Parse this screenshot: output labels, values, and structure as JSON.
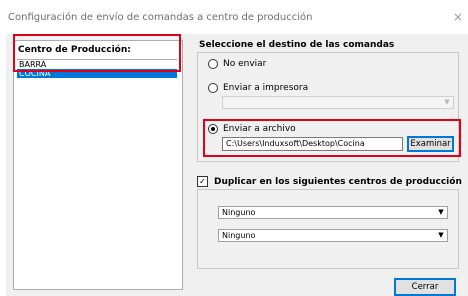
{
  "window": {
    "title": "Configuración de envío de comandas a centro de producción",
    "close_glyph": "×"
  },
  "left_panel": {
    "header": "Centro de Producción:",
    "items": [
      "BARRA",
      "COCINA"
    ],
    "selected_index": 1
  },
  "destination": {
    "header": "Seleccione el destino de las comandas",
    "options": [
      {
        "label": "No enviar",
        "checked": false
      },
      {
        "label": "Enviar a impresora",
        "checked": false
      },
      {
        "label": "Enviar a archivo",
        "checked": true
      }
    ],
    "printer_select_value": "",
    "file_path": "C:\\Users\\Induxsoft\\Desktop\\Cocina",
    "browse_label": "Examinar"
  },
  "duplicate": {
    "label": "Duplicar en los siguientes centros de producción",
    "checked": true,
    "selects": [
      "Ninguno",
      "Ninguno"
    ]
  },
  "footer": {
    "close_label": "Cerrar"
  },
  "colors": {
    "selection": "#0078d7",
    "highlight_border": "#e0001a",
    "client_bg": "#f0f0f0"
  }
}
